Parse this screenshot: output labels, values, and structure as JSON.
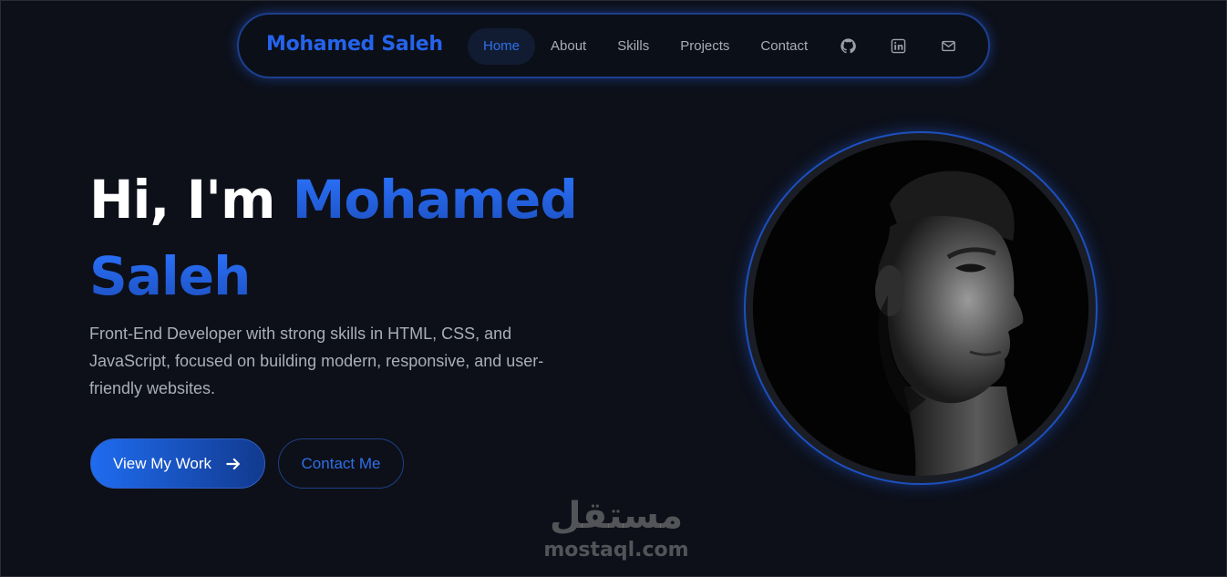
{
  "nav": {
    "brand": "Mohamed Saleh",
    "links": [
      {
        "label": "Home",
        "active": true
      },
      {
        "label": "About",
        "active": false
      },
      {
        "label": "Skills",
        "active": false
      },
      {
        "label": "Projects",
        "active": false
      },
      {
        "label": "Contact",
        "active": false
      }
    ],
    "icons": [
      "github-icon",
      "linkedin-icon",
      "mail-icon"
    ]
  },
  "hero": {
    "greeting": "Hi, I'm",
    "name_first": "Mohamed",
    "name_last": "Saleh",
    "description": "Front-End Developer with strong skills in HTML, CSS, and JavaScript, focused on building modern, responsive, and user-friendly websites.",
    "primary_button": "View My Work",
    "secondary_button": "Contact Me"
  },
  "watermark": {
    "arabic": "مستقل",
    "latin": "mostaql.com"
  },
  "colors": {
    "background": "#0d1019",
    "accent": "#2563eb",
    "text_muted": "#a9aeb8"
  }
}
